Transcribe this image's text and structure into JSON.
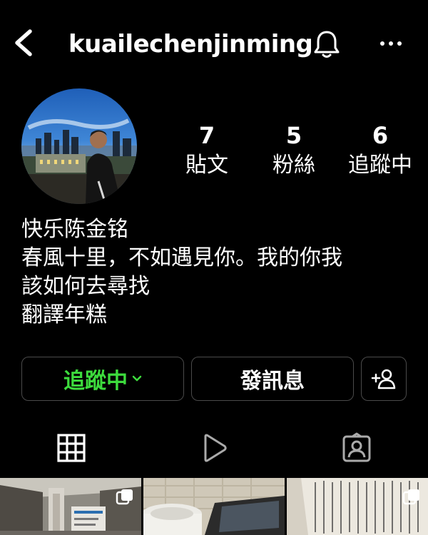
{
  "header": {
    "username": "kuailechenjinming",
    "back_icon": "chevron-left-icon",
    "notification_icon": "bell-icon",
    "more_icon": "more-horizontal-icon"
  },
  "profile": {
    "stats": [
      {
        "value": "7",
        "label": "貼文"
      },
      {
        "value": "5",
        "label": "粉絲"
      },
      {
        "value": "6",
        "label": "追蹤中"
      }
    ],
    "bio": {
      "name": "快乐陈金铭",
      "lines": [
        "春風十里，不如遇見你。我的你我",
        "該如何去尋找",
        "翻譯年糕"
      ]
    }
  },
  "actions": {
    "following_label": "追蹤中",
    "message_label": "發訊息",
    "add_user_icon": "add-user-icon"
  },
  "tabs": [
    {
      "icon": "grid-icon"
    },
    {
      "icon": "reels-play-icon"
    },
    {
      "icon": "tagged-user-icon"
    }
  ],
  "colors": {
    "background": "#000000",
    "following_green": "#3ddc3d",
    "button_border": "#4a4a4a",
    "text": "#ffffff"
  }
}
